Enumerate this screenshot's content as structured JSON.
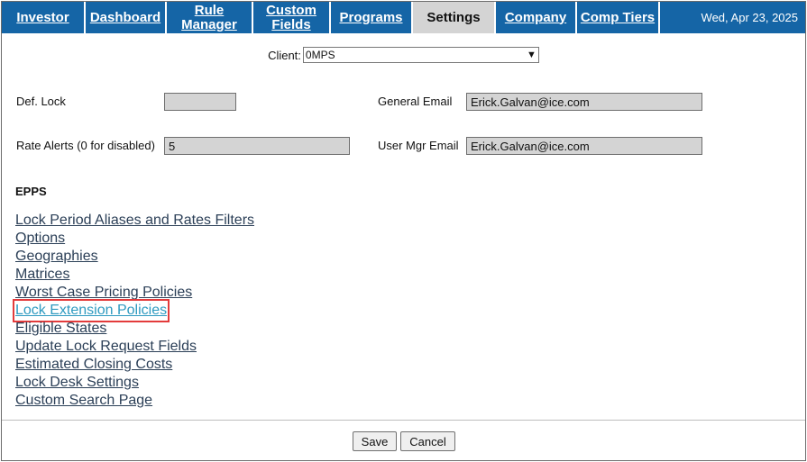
{
  "nav": {
    "tabs": [
      {
        "label": "Investor"
      },
      {
        "label": "Dashboard"
      },
      {
        "label": "Rule Manager"
      },
      {
        "label": "Custom Fields"
      },
      {
        "label": "Programs"
      },
      {
        "label": "Settings"
      },
      {
        "label": "Company"
      },
      {
        "label": "Comp Tiers"
      }
    ],
    "active_tab": "Settings",
    "date": "Wed, Apr 23, 2025"
  },
  "client": {
    "label": "Client:",
    "value": "0MPS"
  },
  "fields": {
    "def_lock": {
      "label": "Def. Lock",
      "value": ""
    },
    "rate_alerts": {
      "label": "Rate Alerts (0 for disabled)",
      "value": "5"
    },
    "general_email": {
      "label": "General Email",
      "value": "Erick.Galvan@ice.com"
    },
    "user_mgr_email": {
      "label": "User Mgr Email",
      "value": "Erick.Galvan@ice.com"
    }
  },
  "epps": {
    "title": "EPPS",
    "links": [
      "Lock Period Aliases and Rates Filters",
      "Options",
      "Geographies",
      "Matrices",
      "Worst Case Pricing Policies",
      "Lock Extension Policies",
      "Eligible States",
      "Update Lock Request Fields",
      "Estimated Closing Costs",
      "Lock Desk Settings",
      "Custom Search Page"
    ]
  },
  "buttons": {
    "save": "Save",
    "cancel": "Cancel"
  },
  "colors": {
    "nav_bg": "#1565a6",
    "active_tab_bg": "#d4d4d4",
    "highlight_border": "#e33b3b"
  }
}
